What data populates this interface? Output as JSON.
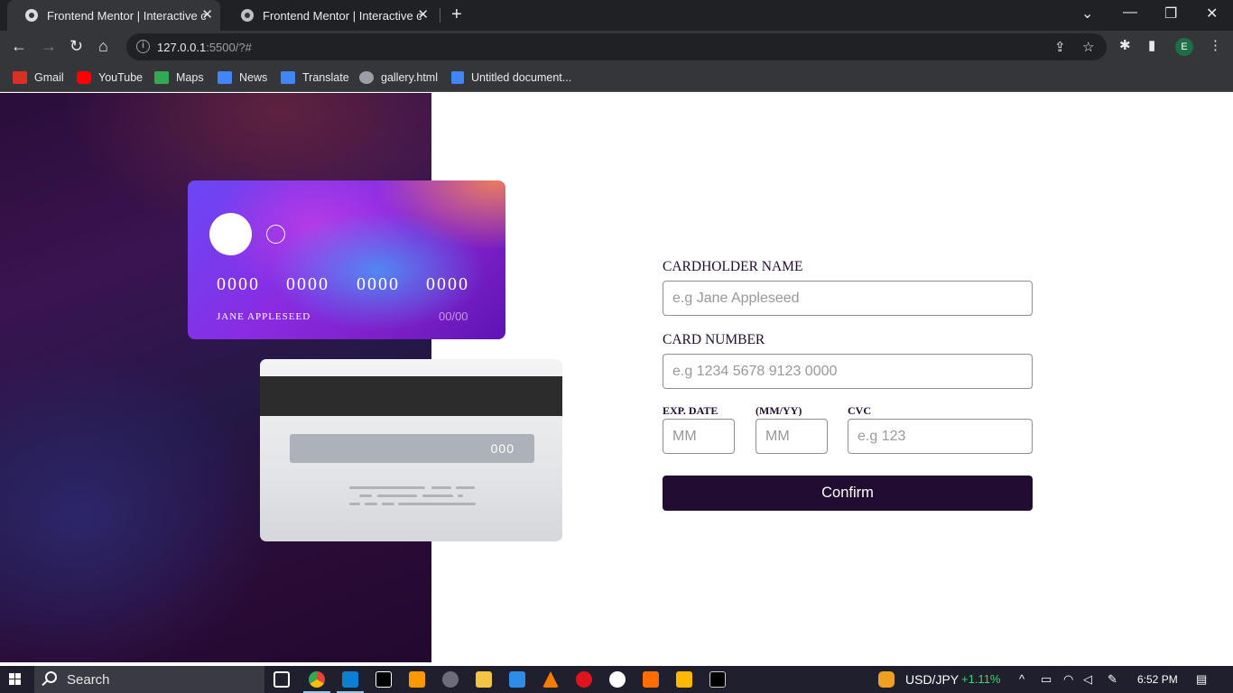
{
  "browser": {
    "tabs": [
      {
        "title": "Frontend Mentor | Interactive card details form"
      },
      {
        "title": "Frontend Mentor | Interactive card details form"
      }
    ],
    "new_tab": "+",
    "address": {
      "host": "127.0.0.1",
      "path": ":5500/?#"
    },
    "profile_initial": "E",
    "bookmarks": [
      {
        "label": "Gmail",
        "color": "#d93025"
      },
      {
        "label": "YouTube",
        "color": "#ff0000"
      },
      {
        "label": "Maps",
        "color": "#34a853"
      },
      {
        "label": "News",
        "color": "#4285f4"
      },
      {
        "label": "Translate",
        "color": "#4285f4"
      },
      {
        "label": "gallery.html",
        "color": "#9aa0a6"
      },
      {
        "label": "Untitled document...",
        "color": "#4285f4"
      }
    ]
  },
  "card_front": {
    "numbers": [
      "0000",
      "0000",
      "0000",
      "0000"
    ],
    "name": "JANE APPLESEED",
    "expiry": "00/00"
  },
  "card_back": {
    "cvc": "000"
  },
  "form": {
    "name_label": "CARDHOLDER NAME",
    "name_placeholder": "e.g Jane Appleseed",
    "number_label": "CARD NUMBER",
    "number_placeholder": "e.g 1234 5678 9123 0000",
    "exp_label": "EXP. DATE",
    "mmyy_label": "(MM/YY)",
    "cvc_label": "CVC",
    "month_placeholder": "MM",
    "year_placeholder": "MM",
    "cvc_placeholder": "e.g 123",
    "confirm": "Confirm"
  },
  "taskbar": {
    "search": "Search",
    "ticker": "USD/JPY",
    "ticker_change": "+1.11%",
    "time": "6:52 PM"
  },
  "colors": {
    "accent_dark": "#220c32",
    "ticker_green": "#3fd36b"
  }
}
